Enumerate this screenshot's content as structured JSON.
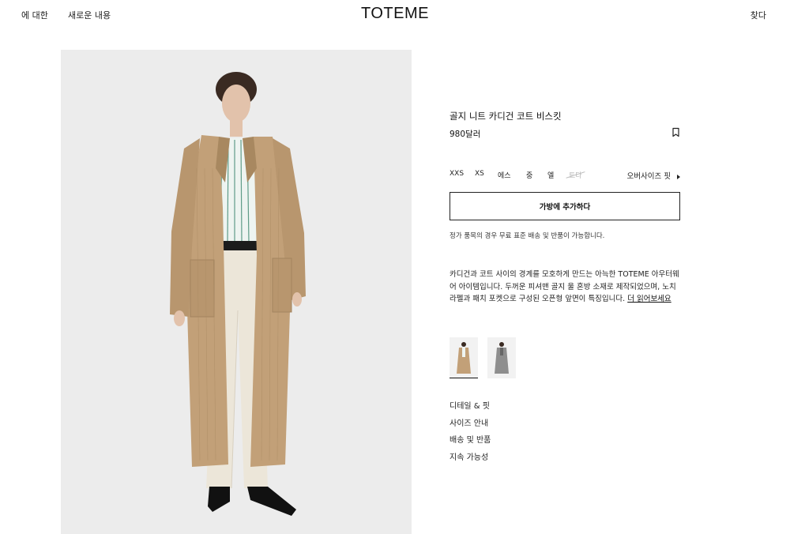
{
  "header": {
    "nav_about": "에 대한",
    "nav_new": "새로운 내용",
    "logo": "TOTEME",
    "search": "찾다"
  },
  "product": {
    "title": "골지 니트 카디건 코트 비스킷",
    "price": "980달러",
    "bookmark_icon": "bookmark-icon",
    "sizes": [
      {
        "label": "XXS",
        "available": true
      },
      {
        "label": "XS",
        "available": true
      },
      {
        "label": "에스",
        "available": true
      },
      {
        "label": "중",
        "available": true
      },
      {
        "label": "엘",
        "available": true
      },
      {
        "label": "트다",
        "available": false
      }
    ],
    "fit_note": "오버사이즈 핏",
    "add_to_bag": "가방에 추가하다",
    "shipping_note": "정가 품목의 경우 무료 표준 배송 및 반품이 가능합니다.",
    "description": "카디건과 코트 사이의 경계를 모호하게 만드는 아늑한 TOTEME 아우터웨어 아이템입니다. 두꺼운 피셔맨 골지 울 혼방 소재로 제작되었으며, 노치 라펠과 패치 포켓으로 구성된 오픈형 앞면이 특징입니다.",
    "read_more": "더 읽어보세요",
    "swatches": [
      "beige-coat-swatch",
      "grey-coat-swatch"
    ],
    "accordion": [
      "디테일 & 핏",
      "사이즈 안내",
      "배송 및 반품",
      "지속 가능성"
    ]
  },
  "colors": {
    "coat": "#c2a078",
    "background_image": "#ececec",
    "grey_coat": "#8e8e8e"
  }
}
